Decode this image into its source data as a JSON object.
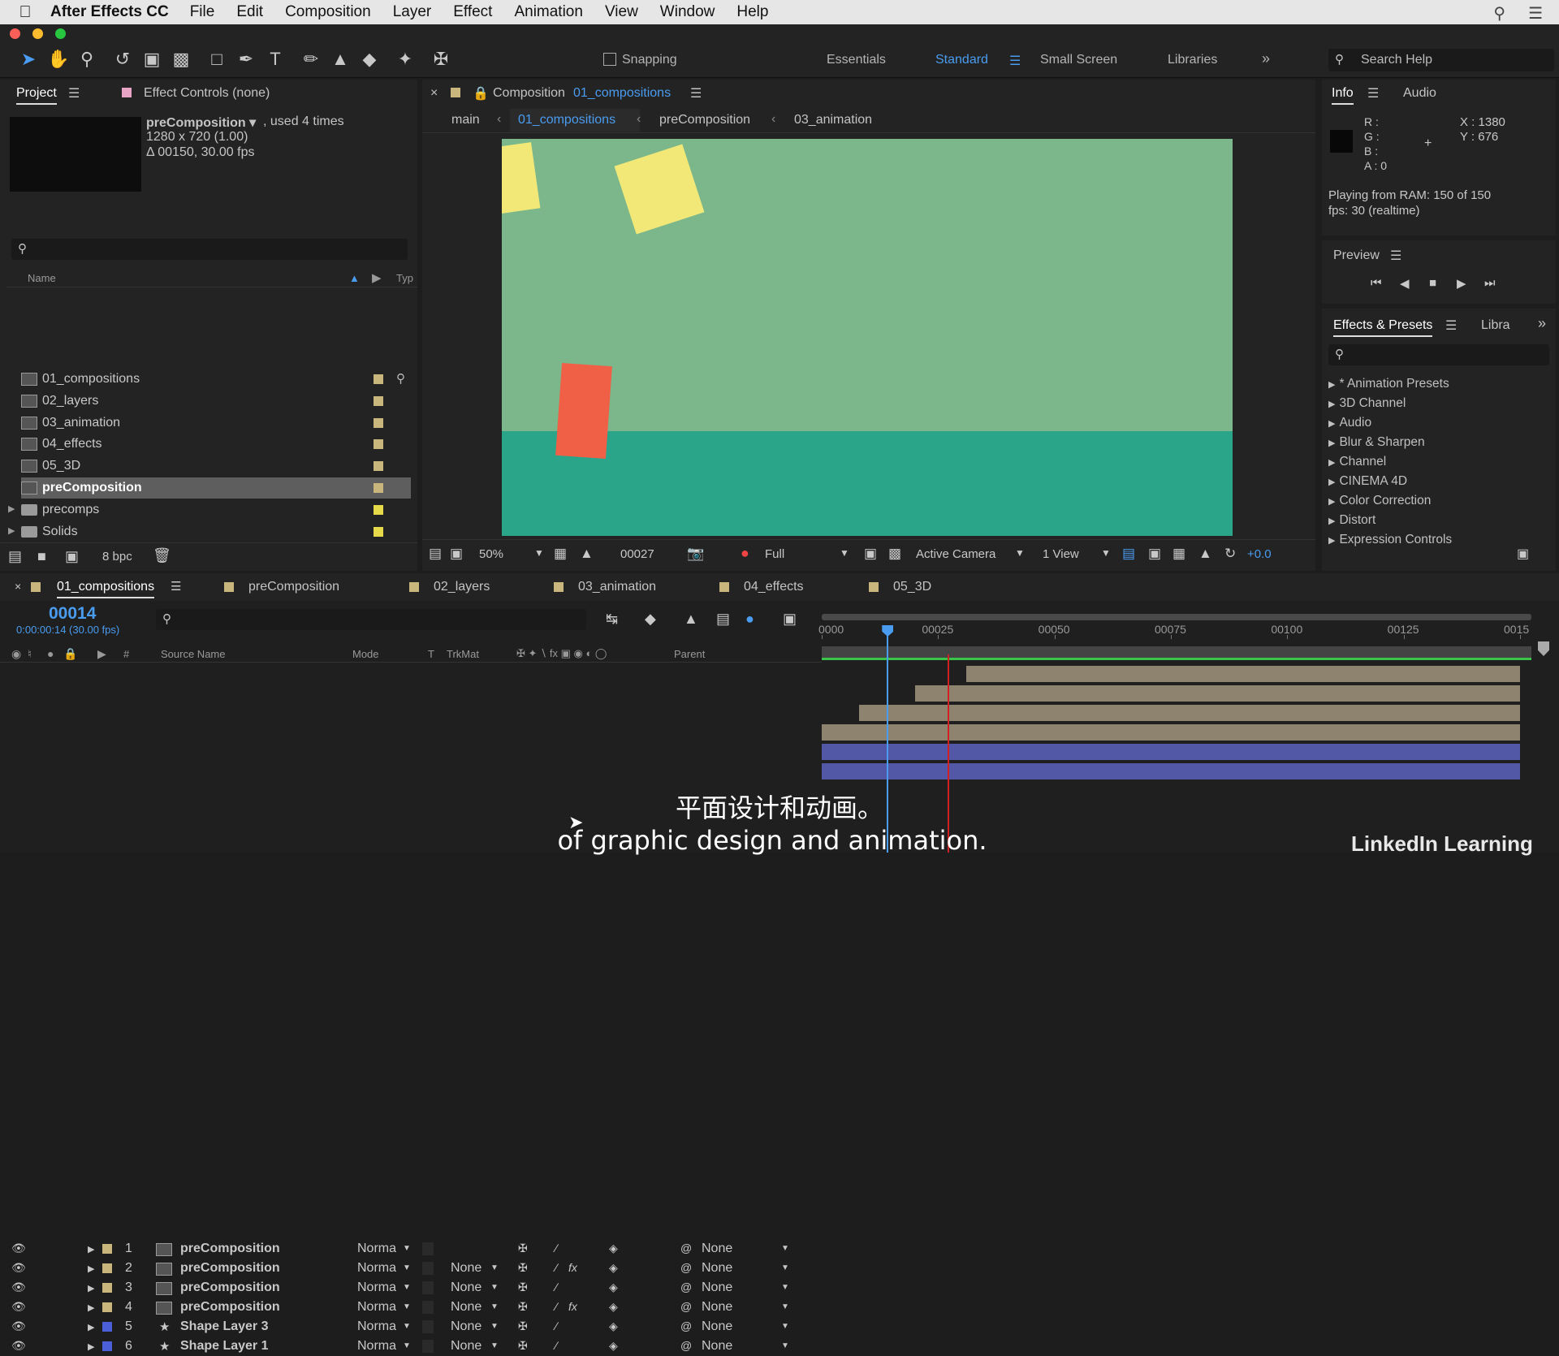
{
  "menubar": {
    "app_name": "After Effects CC",
    "items": [
      "File",
      "Edit",
      "Composition",
      "Layer",
      "Effect",
      "Animation",
      "View",
      "Window",
      "Help"
    ]
  },
  "toolbar": {
    "snapping_label": "Snapping",
    "workspaces": [
      "Essentials",
      "Standard",
      "Small Screen",
      "Libraries"
    ],
    "active_workspace": "Standard",
    "search_placeholder": "Search Help"
  },
  "project_panel": {
    "tab_project": "Project",
    "tab_effect_controls": "Effect Controls (none)",
    "selected_name": "preComposition ▾",
    "used_times": ", used 4 times",
    "dimensions": "1280 x 720 (1.00)",
    "duration": "Δ 00150, 30.00 fps",
    "col_name": "Name",
    "col_type": "Typ",
    "items": [
      {
        "name": "01_compositions",
        "kind": "comp",
        "color": "#c9b67d"
      },
      {
        "name": "02_layers",
        "kind": "comp",
        "color": "#c9b67d"
      },
      {
        "name": "03_animation",
        "kind": "comp",
        "color": "#c9b67d"
      },
      {
        "name": "04_effects",
        "kind": "comp",
        "color": "#c9b67d"
      },
      {
        "name": "05_3D",
        "kind": "comp",
        "color": "#c9b67d"
      },
      {
        "name": "preComposition",
        "kind": "comp",
        "color": "#c9b67d",
        "selected": true
      },
      {
        "name": "precomps",
        "kind": "folder",
        "color": "#e6d94a"
      },
      {
        "name": "Solids",
        "kind": "folder",
        "color": "#e6d94a"
      }
    ],
    "bpc": "8 bpc"
  },
  "composition_panel": {
    "tab_prefix": "Composition",
    "tab_name": "01_compositions",
    "breadcrumbs": [
      "main",
      "01_compositions",
      "preComposition",
      "03_animation"
    ],
    "active_breadcrumb": "01_compositions",
    "zoom": "50%",
    "timecode": "00027",
    "resolution": "Full",
    "camera": "Active Camera",
    "views": "1 View",
    "exposure": "+0.0",
    "colors": {
      "sky": "#7bb78b",
      "ground": "#2aa58a",
      "yellow": "#f2e878",
      "orange": "#f06046"
    }
  },
  "info_panel": {
    "tab_info": "Info",
    "tab_audio": "Audio",
    "r": "R :",
    "g": "G :",
    "b": "B :",
    "a": "A : 0",
    "x": "X : 1380",
    "y": "Y : 676",
    "playing": "Playing from RAM: 150 of 150",
    "fps": "fps: 30 (realtime)"
  },
  "preview_panel": {
    "title": "Preview"
  },
  "effects_panel": {
    "tab": "Effects & Presets",
    "tab2": "Libra",
    "items": [
      "* Animation Presets",
      "3D Channel",
      "Audio",
      "Blur & Sharpen",
      "Channel",
      "CINEMA 4D",
      "Color Correction",
      "Distort",
      "Expression Controls"
    ]
  },
  "timeline": {
    "tabs": [
      {
        "name": "01_compositions",
        "color": "#c9b67d",
        "active": true
      },
      {
        "name": "preComposition",
        "color": "#c9b67d"
      },
      {
        "name": "02_layers",
        "color": "#c9b67d"
      },
      {
        "name": "03_animation",
        "color": "#c9b67d"
      },
      {
        "name": "04_effects",
        "color": "#c9b67d"
      },
      {
        "name": "05_3D",
        "color": "#c9b67d"
      }
    ],
    "current_time": "00014",
    "sub_time": "0:00:00:14 (30.00 fps)",
    "headers": {
      "source": "Source Name",
      "mode": "Mode",
      "t": "T",
      "trkmat": "TrkMat",
      "parent": "Parent"
    },
    "ruler": [
      "0000",
      "00025",
      "00050",
      "00075",
      "00100",
      "00125",
      "0015"
    ],
    "playhead_frame": 14,
    "total_frames": 150,
    "layers": [
      {
        "num": "1",
        "name": "preComposition",
        "mode": "Norma",
        "trkmat": "",
        "parent": "None",
        "color": "#c9b67d",
        "type": "comp",
        "fx": false,
        "start": 31,
        "end": 150
      },
      {
        "num": "2",
        "name": "preComposition",
        "mode": "Norma",
        "trkmat": "None",
        "parent": "None",
        "color": "#c9b67d",
        "type": "comp",
        "fx": true,
        "start": 20,
        "end": 150
      },
      {
        "num": "3",
        "name": "preComposition",
        "mode": "Norma",
        "trkmat": "None",
        "parent": "None",
        "color": "#c9b67d",
        "type": "comp",
        "fx": false,
        "start": 8,
        "end": 150
      },
      {
        "num": "4",
        "name": "preComposition",
        "mode": "Norma",
        "trkmat": "None",
        "parent": "None",
        "color": "#c9b67d",
        "type": "comp",
        "fx": true,
        "start": 0,
        "end": 150
      },
      {
        "num": "5",
        "name": "Shape Layer 3",
        "mode": "Norma",
        "trkmat": "None",
        "parent": "None",
        "color": "#4a5fd8",
        "type": "shape",
        "fx": false,
        "start": 0,
        "end": 150
      },
      {
        "num": "6",
        "name": "Shape Layer 1",
        "mode": "Norma",
        "trkmat": "None",
        "parent": "None",
        "color": "#4a5fd8",
        "type": "shape",
        "fx": false,
        "start": 0,
        "end": 150
      }
    ]
  },
  "subtitles": {
    "line1": "平面设计和动画。",
    "line2": "of graphic design and animation."
  },
  "watermark": "LinkedIn Learning"
}
